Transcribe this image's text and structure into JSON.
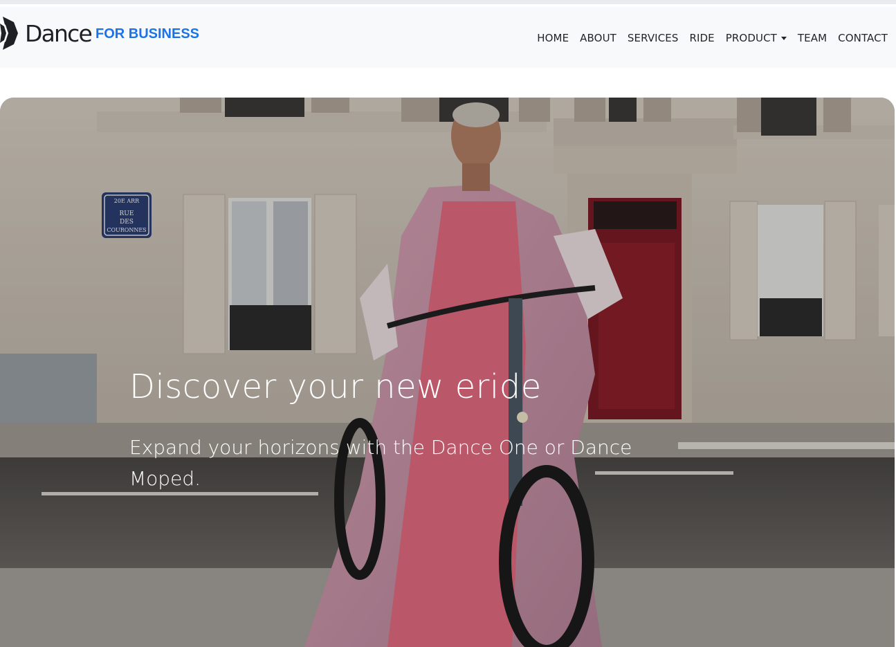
{
  "brand": {
    "logo_icon": "dance-logo-icon",
    "name": "Dance",
    "tagline": "FOR BUSINESS",
    "tagline_color": "#1a73e8"
  },
  "nav": {
    "items": [
      {
        "label": "HOME"
      },
      {
        "label": "ABOUT"
      },
      {
        "label": "SERVICES"
      },
      {
        "label": "RIDE"
      },
      {
        "label": "PRODUCT",
        "dropdown": true
      },
      {
        "label": "TEAM"
      },
      {
        "label": "CONTACT"
      }
    ]
  },
  "hero": {
    "title": "Discover your new eride",
    "subtitle": "Expand your horizons with the Dance One or Dance Moped.",
    "image": "woman-on-ebike-paris-street-photo",
    "street_sign": [
      "20E ARR",
      "RUE",
      "DES",
      "COURONNES"
    ]
  }
}
